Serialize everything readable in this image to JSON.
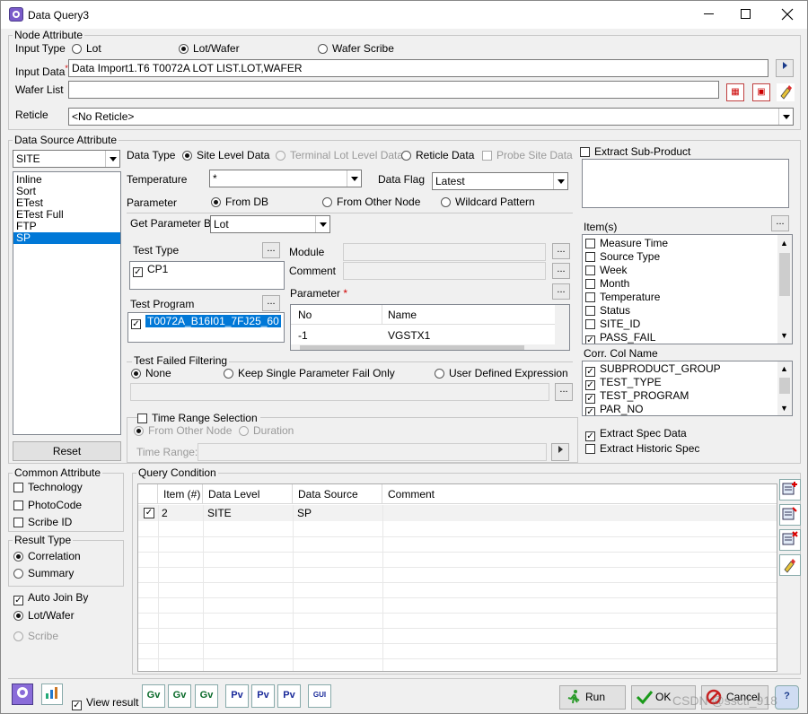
{
  "window": {
    "title": "Data Query3",
    "minimize_icon": "minimize-icon",
    "maximize_icon": "maximize-icon",
    "close_icon": "close-icon"
  },
  "node_attribute": {
    "title": "Node Attribute",
    "input_type_label": "Input Type",
    "input_type_options": [
      "Lot",
      "Lot/Wafer",
      "Wafer Scribe"
    ],
    "input_type_selected": "Lot/Wafer",
    "input_data_label": "Input Data",
    "required_mark": "*",
    "input_data_value": "Data Import1.T6 T0072A LOT LIST.LOT,WAFER",
    "wafer_list_label": "Wafer List",
    "wafer_list_value": "",
    "reticle_label": "Reticle",
    "reticle_value": "<No Reticle>"
  },
  "data_source": {
    "title": "Data Source Attribute",
    "source_combo": "SITE",
    "source_list": [
      "Inline",
      "Sort",
      "ETest",
      "ETest Full",
      "FTP",
      "SP"
    ],
    "source_selected": "SP",
    "reset_label": "Reset",
    "data_type_label": "Data Type",
    "data_type_options": [
      "Site Level Data",
      "Terminal Lot Level Data",
      "Reticle Data"
    ],
    "data_type_selected": "Site Level Data",
    "probe_site_label": "Probe Site Data",
    "temperature_label": "Temperature",
    "temperature_value": "*",
    "data_flag_label": "Data Flag",
    "data_flag_value": "Latest",
    "parameter_label": "Parameter",
    "parameter_options": [
      "From DB",
      "From Other Node",
      "Wildcard Pattern"
    ],
    "parameter_selected": "From DB",
    "get_param_label": "Get Parameter By",
    "get_param_value": "Lot",
    "test_type_label": "Test Type",
    "test_types": [
      {
        "label": "CP1",
        "checked": true
      }
    ],
    "test_program_label": "Test Program",
    "test_programs": [
      {
        "label": "T0072A_B16I01_7FJ25_60",
        "checked": true
      }
    ],
    "module_label": "Module",
    "comment_label": "Comment",
    "parameter_table_label": "Parameter",
    "param_columns": [
      "No",
      "Name"
    ],
    "param_rows": [
      [
        "-1",
        "VGSTX1"
      ]
    ],
    "ellipsis": "..."
  },
  "test_failed": {
    "title": "Test Failed Filtering",
    "options": [
      "None",
      "Keep Single Parameter Fail Only",
      "User Defined Expression"
    ],
    "selected": "None"
  },
  "time_range": {
    "title": "Time Range Selection",
    "options": [
      "From Other Node",
      "Duration"
    ],
    "time_range_label": "Time Range:"
  },
  "right_panel": {
    "extract_sub_product": "Extract Sub-Product",
    "items_label": "Item(s)",
    "items": [
      {
        "label": "Measure Time",
        "checked": false
      },
      {
        "label": "Source Type",
        "checked": false
      },
      {
        "label": "Week",
        "checked": false
      },
      {
        "label": "Month",
        "checked": false
      },
      {
        "label": "Temperature",
        "checked": false
      },
      {
        "label": "Status",
        "checked": false
      },
      {
        "label": "SITE_ID",
        "checked": false
      },
      {
        "label": "PASS_FAIL",
        "checked": true
      }
    ],
    "corr_label": "Corr. Col Name",
    "corr_items": [
      {
        "label": "SUBPRODUCT_GROUP",
        "checked": true
      },
      {
        "label": "TEST_TYPE",
        "checked": true
      },
      {
        "label": "TEST_PROGRAM",
        "checked": true
      },
      {
        "label": "PAR_NO",
        "checked": true
      }
    ],
    "extract_spec": "Extract Spec Data",
    "extract_historic": "Extract Historic Spec"
  },
  "common_attribute": {
    "title": "Common Attribute",
    "items": [
      "Technology",
      "PhotoCode",
      "Scribe ID"
    ]
  },
  "result_type": {
    "title": "Result Type",
    "options": [
      "Correlation",
      "Summary"
    ],
    "selected": "Correlation"
  },
  "auto_join": {
    "label": "Auto Join By",
    "options": [
      "Lot/Wafer",
      "Scribe"
    ],
    "selected": "Lot/Wafer"
  },
  "query_condition": {
    "title": "Query Condition",
    "columns": [
      "Item (#)",
      "Data Level",
      "Data Source",
      "Comment"
    ],
    "rows": [
      {
        "checked": true,
        "item": "2",
        "level": "SITE",
        "source": "SP",
        "comment": ""
      }
    ],
    "side_icons": [
      "add-condition-icon",
      "edit-condition-icon",
      "delete-condition-icon",
      "clear-condition-icon"
    ]
  },
  "footer": {
    "view_result": "View result",
    "tool_icons": [
      "Gv",
      "Gv",
      "Gv",
      "Pv",
      "Pv",
      "Pv",
      "GUI"
    ],
    "run": "Run",
    "ok": "OK",
    "cancel": "Cancel",
    "watermark": "CSDN @ssctl_918"
  },
  "colors": {
    "selection": "#0078d7",
    "required": "#d00000",
    "disabled_text": "#9a9a9a"
  }
}
